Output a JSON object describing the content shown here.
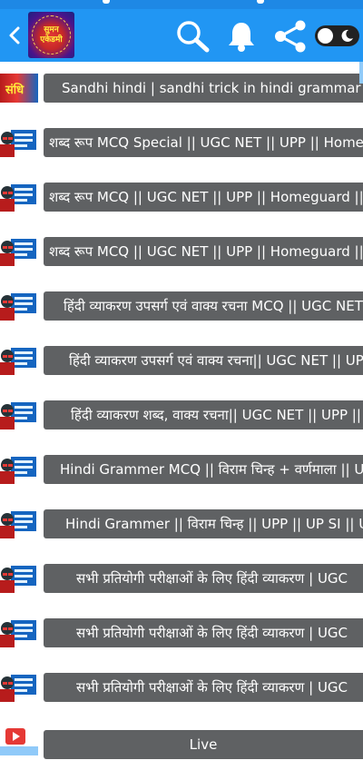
{
  "app": {
    "logo_line1": "सुमन",
    "logo_line2": "एकेडमी",
    "first_thumb_text": "संधि"
  },
  "header": {
    "back_icon": "chevron-left-icon",
    "search_icon": "search-icon",
    "bell_icon": "bell-icon",
    "share_icon": "share-icon",
    "theme_toggle": "dark-mode-toggle"
  },
  "videos": [
    {
      "title": "Sandhi hindi | sandhi trick in hindi grammar | s"
    },
    {
      "title": "शब्द रूप MCQ Special || UGC NET || UPP || Homegua"
    },
    {
      "title": "शब्द रूप MCQ || UGC NET || UPP || Homeguard || UP"
    },
    {
      "title": "शब्द रूप MCQ || UGC NET || UPP || Homeguard || UP"
    },
    {
      "title": "हिंदी व्याकरण उपसर्ग एवं वाक्य रचना MCQ || UGC NET"
    },
    {
      "title": "हिंदी व्याकरण उपसर्ग एवं वाक्य रचना|| UGC NET || UP"
    },
    {
      "title": "हिंदी व्याकरण शब्द, वाक्य रचना|| UGC NET || UPP ||"
    },
    {
      "title": "Hindi Grammer MCQ || विराम चिन्ह + वर्णमाला || UPP"
    },
    {
      "title": "Hindi Grammer || विराम चिन्ह || UPP || UP SI || UG"
    },
    {
      "title": "सभी प्रतियोगी परीक्षाओं के लिए हिंदी व्याकरण | UGC"
    },
    {
      "title": "सभी प्रतियोगी परीक्षाओं के लिए हिंदी व्याकरण | UGC"
    },
    {
      "title": "सभी प्रतियोगी परीक्षाओं के लिए हिंदी व्याकरण | UGC"
    },
    {
      "title": "Live"
    }
  ],
  "colors": {
    "topbar": "#2196f3",
    "pill": "#5f6163"
  }
}
